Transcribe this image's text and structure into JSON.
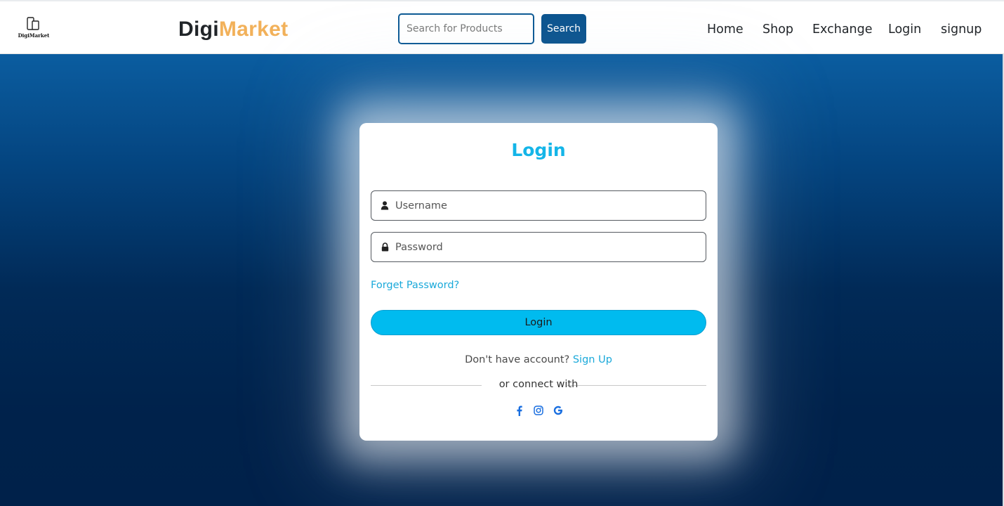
{
  "header": {
    "logo_caption": "DigiMarket",
    "brand_part1": "Digi",
    "brand_part2": "Market",
    "search_placeholder": "Search for Products",
    "search_button": "Search",
    "nav": [
      {
        "label": "Home"
      },
      {
        "label": "Shop"
      },
      {
        "label": "Exchange"
      },
      {
        "label": "Login"
      },
      {
        "label": "signup"
      }
    ]
  },
  "login_card": {
    "title": "Login",
    "username_placeholder": "Username",
    "password_placeholder": "Password",
    "forgot_link": "Forget Password?",
    "submit_label": "Login",
    "no_account_text": "Don't have account?",
    "signup_link": "Sign Up",
    "divider_text": "or connect with",
    "socials": [
      {
        "icon": "facebook-icon"
      },
      {
        "icon": "instagram-icon"
      },
      {
        "icon": "google-icon"
      }
    ]
  },
  "colors": {
    "accent": "#14b5e8",
    "button": "#00bbef",
    "nav_search_button": "#0c548f",
    "brand_market": "#f2b15a",
    "social_icons": "#1a6fe0"
  }
}
